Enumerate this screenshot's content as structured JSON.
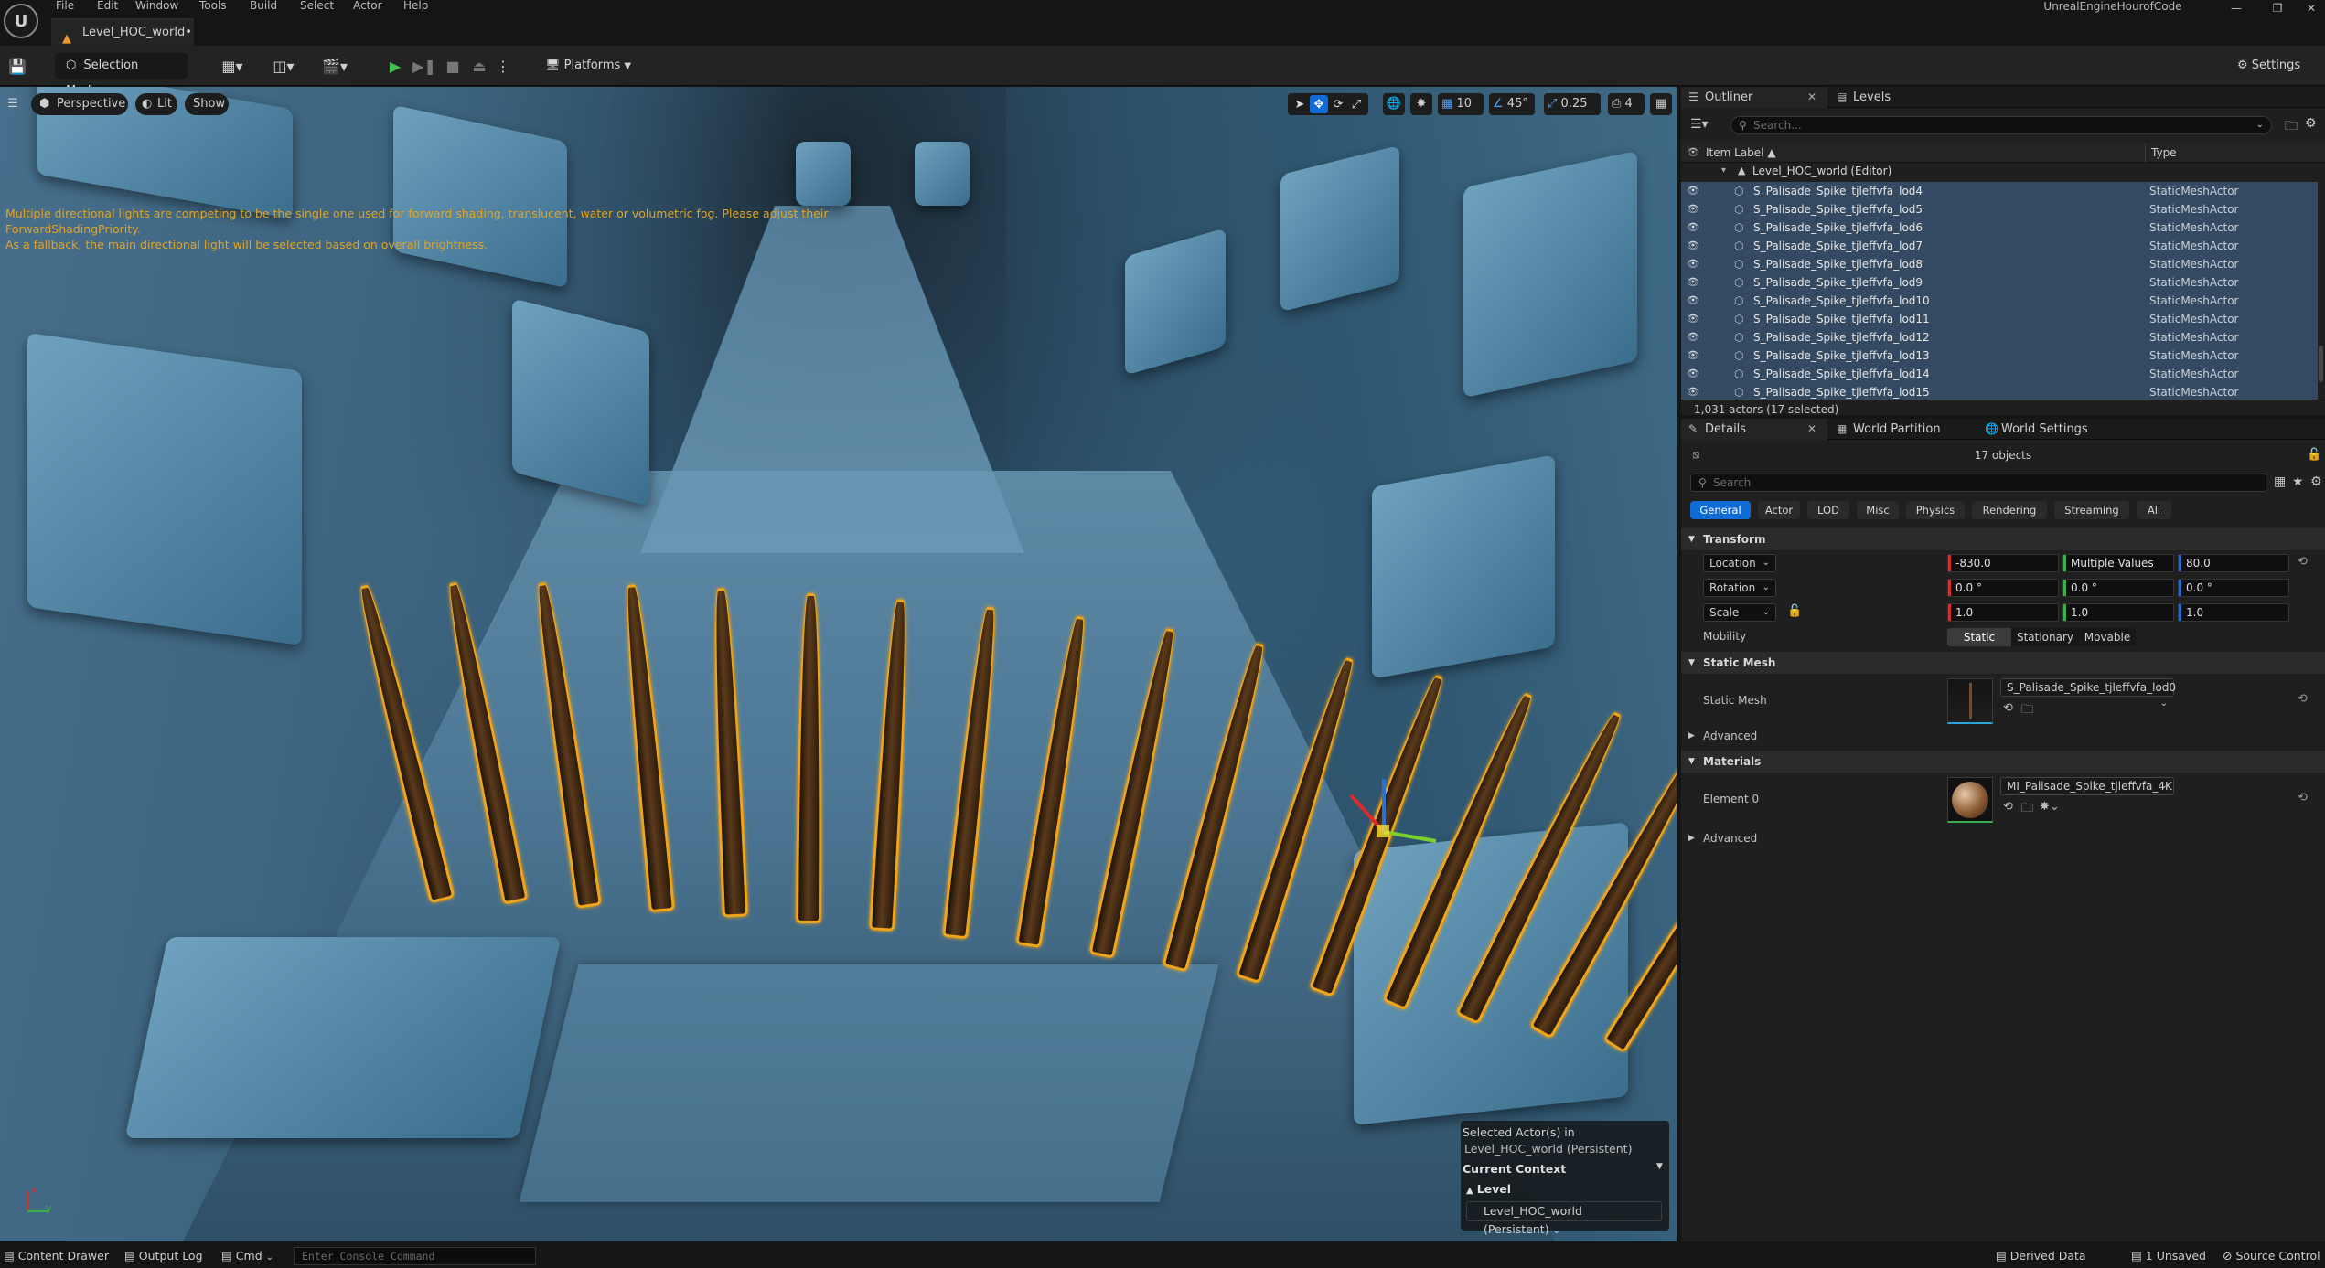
{
  "window": {
    "app_name": "UnrealEngineHourofCode",
    "level_tab": "Level_HOC_world•",
    "logo": "U"
  },
  "menu": [
    "File",
    "Edit",
    "Window",
    "Tools",
    "Build",
    "Select",
    "Actor",
    "Help"
  ],
  "window_controls": [
    "—",
    "❐",
    "✕"
  ],
  "toolbar": {
    "selection_mode": "Selection Mode",
    "platforms": "Platforms",
    "settings": "Settings"
  },
  "viewport": {
    "perspective": "Perspective",
    "lit": "Lit",
    "show": "Show",
    "grid_snap": "10",
    "rotation_snap": "45°",
    "scale_snap": "0.25",
    "camera_speed": "4",
    "warning_line1": "Multiple directional lights are competing to be the single one used for forward shading, translucent, water or volumetric fog. Please adjust their ForwardShadingPriority.",
    "warning_line2": "As a fallback, the main directional light will be selected based on overall brightness.",
    "axis_x": "x",
    "axis_y": "y",
    "spike_count": 17,
    "context": {
      "selected_label": "Selected Actor(s) in",
      "selected_world": "Level_HOC_world (Persistent)",
      "current_context": "Current Context",
      "level_label": "Level",
      "level_value": "Level_HOC_world (Persistent)"
    }
  },
  "outliner": {
    "tab": "Outliner",
    "levels_tab": "Levels",
    "search_placeholder": "Search...",
    "col_label": "Item Label ▲",
    "col_type": "Type",
    "world_row": "Level_HOC_world (Editor)",
    "rows": [
      {
        "label": "S_Palisade_Spike_tjleffvfa_lod4",
        "type": "StaticMeshActor"
      },
      {
        "label": "S_Palisade_Spike_tjleffvfa_lod5",
        "type": "StaticMeshActor"
      },
      {
        "label": "S_Palisade_Spike_tjleffvfa_lod6",
        "type": "StaticMeshActor"
      },
      {
        "label": "S_Palisade_Spike_tjleffvfa_lod7",
        "type": "StaticMeshActor"
      },
      {
        "label": "S_Palisade_Spike_tjleffvfa_lod8",
        "type": "StaticMeshActor"
      },
      {
        "label": "S_Palisade_Spike_tjleffvfa_lod9",
        "type": "StaticMeshActor"
      },
      {
        "label": "S_Palisade_Spike_tjleffvfa_lod10",
        "type": "StaticMeshActor"
      },
      {
        "label": "S_Palisade_Spike_tjleffvfa_lod11",
        "type": "StaticMeshActor"
      },
      {
        "label": "S_Palisade_Spike_tjleffvfa_lod12",
        "type": "StaticMeshActor"
      },
      {
        "label": "S_Palisade_Spike_tjleffvfa_lod13",
        "type": "StaticMeshActor"
      },
      {
        "label": "S_Palisade_Spike_tjleffvfa_lod14",
        "type": "StaticMeshActor"
      },
      {
        "label": "S_Palisade_Spike_tjleffvfa_lod15",
        "type": "StaticMeshActor"
      }
    ],
    "status": "1,031 actors (17 selected)"
  },
  "details": {
    "tab": "Details",
    "world_partition_tab": "World Partition",
    "world_settings_tab": "World Settings",
    "objects": "17 objects",
    "search_placeholder": "Search",
    "categories": [
      "General",
      "Actor",
      "LOD",
      "Misc",
      "Physics",
      "Rendering",
      "Streaming",
      "All"
    ],
    "transform": {
      "title": "Transform",
      "location_label": "Location",
      "rotation_label": "Rotation",
      "scale_label": "Scale",
      "location": [
        "-830.0",
        "Multiple Values",
        "80.0"
      ],
      "rotation": [
        "0.0 °",
        "0.0 °",
        "0.0 °"
      ],
      "scale": [
        "1.0",
        "1.0",
        "1.0"
      ],
      "mobility_label": "Mobility",
      "mobility_options": [
        "Static",
        "Stationary",
        "Movable"
      ],
      "mobility_selected": "Static"
    },
    "static_mesh": {
      "title": "Static Mesh",
      "label": "Static Mesh",
      "value": "S_Palisade_Spike_tjleffvfa_lod0",
      "advanced": "Advanced"
    },
    "materials": {
      "title": "Materials",
      "label": "Element 0",
      "value": "MI_Palisade_Spike_tjleffvfa_4K",
      "advanced": "Advanced"
    }
  },
  "statusbar": {
    "content_drawer": "Content Drawer",
    "output_log": "Output Log",
    "cmd": "Cmd",
    "console_placeholder": "Enter Console Command",
    "derived_data": "Derived Data",
    "unsaved": "1 Unsaved",
    "source_control": "Source Control"
  },
  "colors": {
    "selection_outline": "#f1a416",
    "accent_blue": "#0f6bd6",
    "warning_text": "#e3a322"
  }
}
